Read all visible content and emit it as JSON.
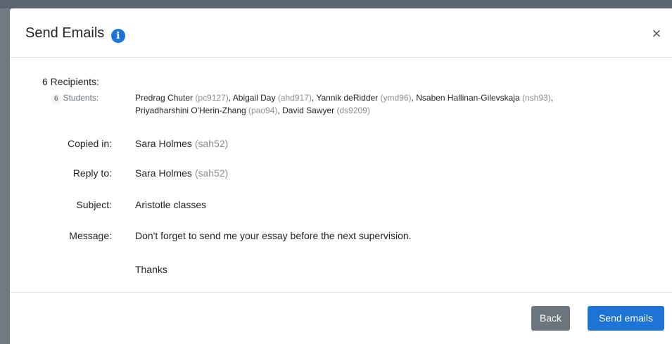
{
  "modal": {
    "title": "Send Emails",
    "close_symbol": "×",
    "info_symbol": "i"
  },
  "recipients": {
    "heading": "6 Recipients:",
    "students_count": "6",
    "students_label": "Students:",
    "students": [
      {
        "name": "Predrag Chuter",
        "uid": "(pc9127)",
        "sep": ","
      },
      {
        "name": "Abigail Day",
        "uid": "(ahd917)",
        "sep": ","
      },
      {
        "name": "Yannik deRidder",
        "uid": "(ymd96)",
        "sep": ","
      },
      {
        "name": "Nsaben Hallinan-Gilevskaja",
        "uid": "(nsh93)",
        "sep": ","
      },
      {
        "name": "Priyadharshini O'Herin-Zhang",
        "uid": "(pao94)",
        "sep": ","
      },
      {
        "name": "David Sawyer",
        "uid": "(ds9209)",
        "sep": ""
      }
    ]
  },
  "fields": {
    "copied_in_label": "Copied in:",
    "copied_in_name": "Sara Holmes",
    "copied_in_uid": "(sah52)",
    "reply_to_label": "Reply to:",
    "reply_to_name": "Sara Holmes",
    "reply_to_uid": "(sah52)",
    "subject_label": "Subject:",
    "subject_value": "Aristotle classes",
    "message_label": "Message:",
    "message_line1": "Don't forget to send me your essay before the next supervision.",
    "message_line2": "Thanks"
  },
  "footer": {
    "back_label": "Back",
    "send_label": "Send emails"
  },
  "colors": {
    "primary": "#1e74d6",
    "secondary": "#6c757d",
    "uid_text": "#8a8f94"
  },
  "icons": {
    "info": "info-circle-icon",
    "close": "close-icon"
  }
}
